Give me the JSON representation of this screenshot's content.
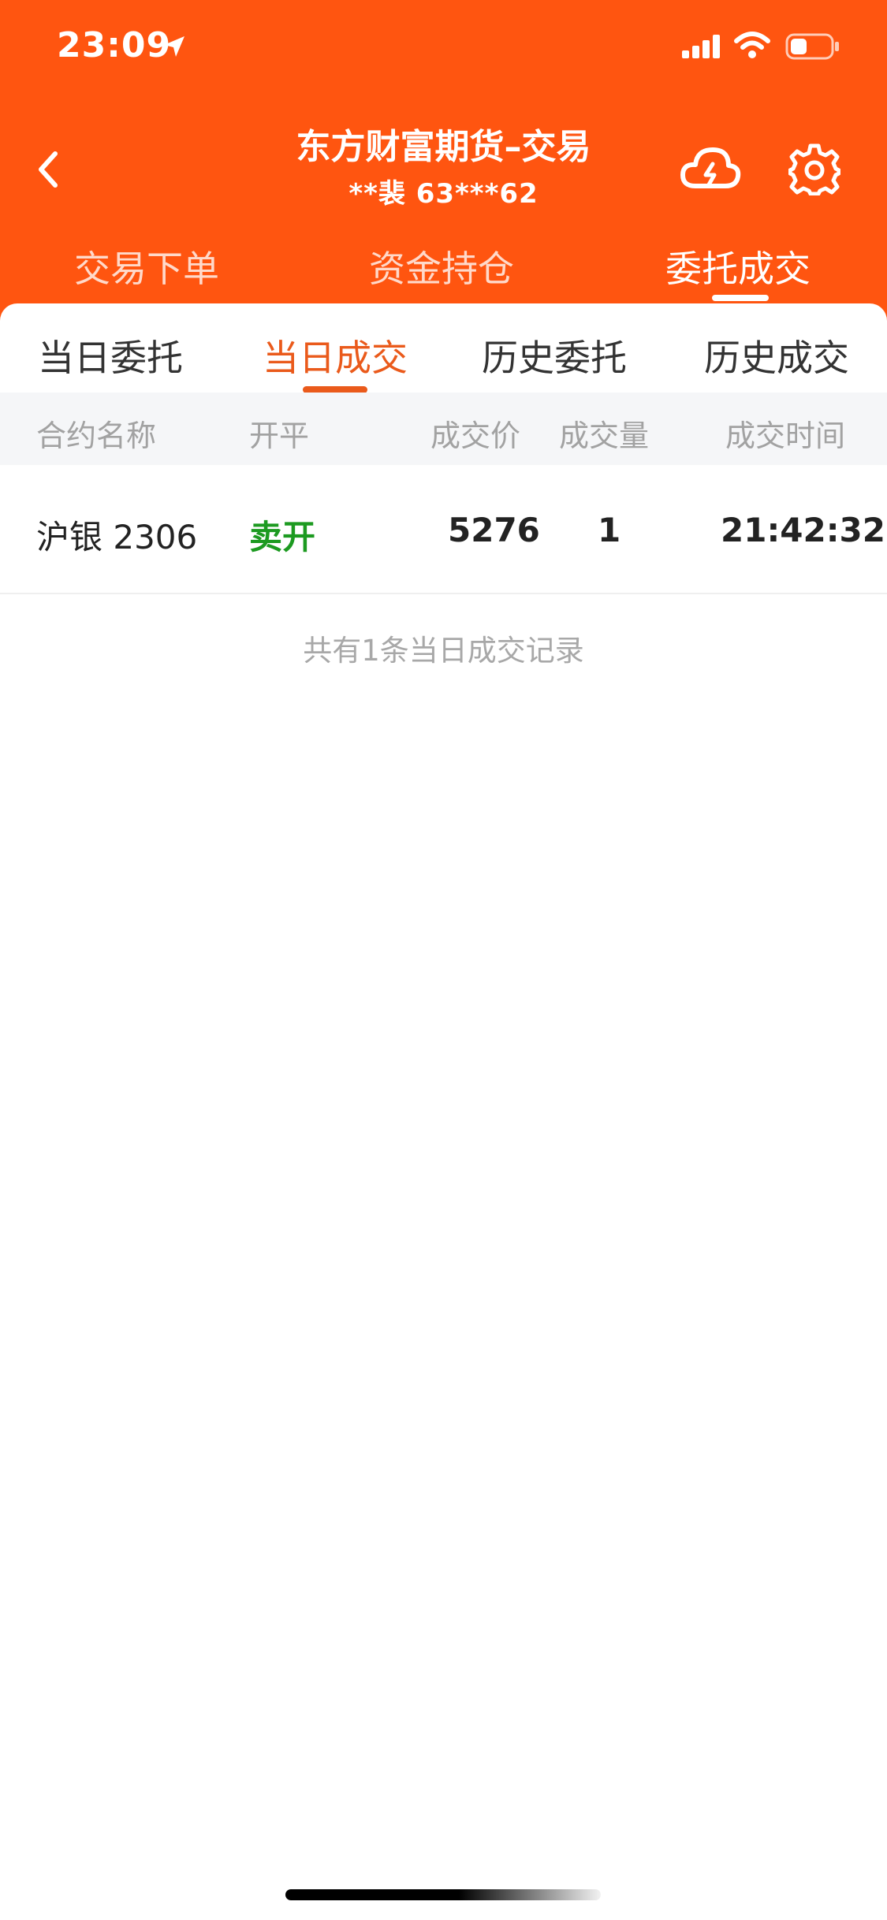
{
  "status_bar": {
    "time": "23:09"
  },
  "header": {
    "title": "东方财富期货–交易",
    "subtitle": "**裴  63***62"
  },
  "main_tabs": [
    {
      "label": "交易下单"
    },
    {
      "label": "资金持仓"
    },
    {
      "label": "委托成交",
      "active": true
    }
  ],
  "sub_tabs": [
    {
      "label": "当日委托"
    },
    {
      "label": "当日成交",
      "active": true
    },
    {
      "label": "历史委托"
    },
    {
      "label": "历史成交"
    }
  ],
  "table": {
    "columns": [
      "合约名称",
      "开平",
      "成交价",
      "成交量",
      "成交时间"
    ],
    "rows": [
      {
        "contract": "沪银 2306",
        "open_close": "卖开",
        "price": "5276",
        "volume": "1",
        "time": "21:42:32"
      }
    ]
  },
  "summary": "共有1条当日成交记录",
  "colors": {
    "brand": "#ff5510",
    "accent": "#ea5a1b",
    "sell_open": "#1c9a20"
  },
  "icons": [
    "location-arrow-icon",
    "signal-icon",
    "wifi-icon",
    "battery-icon",
    "back-icon",
    "cloud-icon",
    "gear-icon"
  ]
}
